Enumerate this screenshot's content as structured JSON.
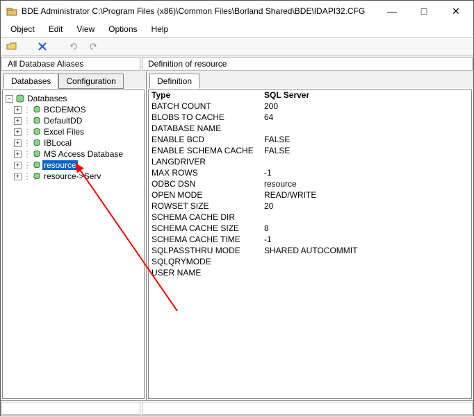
{
  "window": {
    "title": "BDE Administrator  C:\\Program Files (x86)\\Common Files\\Borland Shared\\BDE\\IDAPI32.CFG",
    "min": "—",
    "max": "□",
    "close": "✕"
  },
  "menubar": {
    "items": [
      "Object",
      "Edit",
      "View",
      "Options",
      "Help"
    ]
  },
  "infobar": {
    "left": "All Database Aliases",
    "right": "Definition of resource"
  },
  "leftTabs": {
    "active": "Databases",
    "inactive": "Configuration"
  },
  "rightTabs": {
    "active": "Definition"
  },
  "tree": {
    "root": "Databases",
    "items": [
      "BCDEMOS",
      "DefaultDD",
      "Excel Files",
      "IBLocal",
      "MS Access Database",
      "resource",
      "resource->Serv"
    ],
    "selectedIndex": 5
  },
  "props": {
    "headerKey": "Type",
    "headerVal": "SQL Server",
    "rows": [
      {
        "k": "BATCH COUNT",
        "v": "200"
      },
      {
        "k": "BLOBS TO CACHE",
        "v": "64"
      },
      {
        "k": "DATABASE NAME",
        "v": ""
      },
      {
        "k": "ENABLE BCD",
        "v": "FALSE"
      },
      {
        "k": "ENABLE SCHEMA CACHE",
        "v": "FALSE"
      },
      {
        "k": "LANGDRIVER",
        "v": ""
      },
      {
        "k": "MAX ROWS",
        "v": "-1"
      },
      {
        "k": "ODBC DSN",
        "v": "resource"
      },
      {
        "k": "OPEN MODE",
        "v": "READ/WRITE"
      },
      {
        "k": "ROWSET SIZE",
        "v": "20"
      },
      {
        "k": "SCHEMA CACHE DIR",
        "v": ""
      },
      {
        "k": "SCHEMA CACHE SIZE",
        "v": "8"
      },
      {
        "k": "SCHEMA CACHE TIME",
        "v": "-1"
      },
      {
        "k": "SQLPASSTHRU MODE",
        "v": "SHARED AUTOCOMMIT"
      },
      {
        "k": "SQLQRYMODE",
        "v": ""
      },
      {
        "k": "USER NAME",
        "v": ""
      }
    ]
  }
}
